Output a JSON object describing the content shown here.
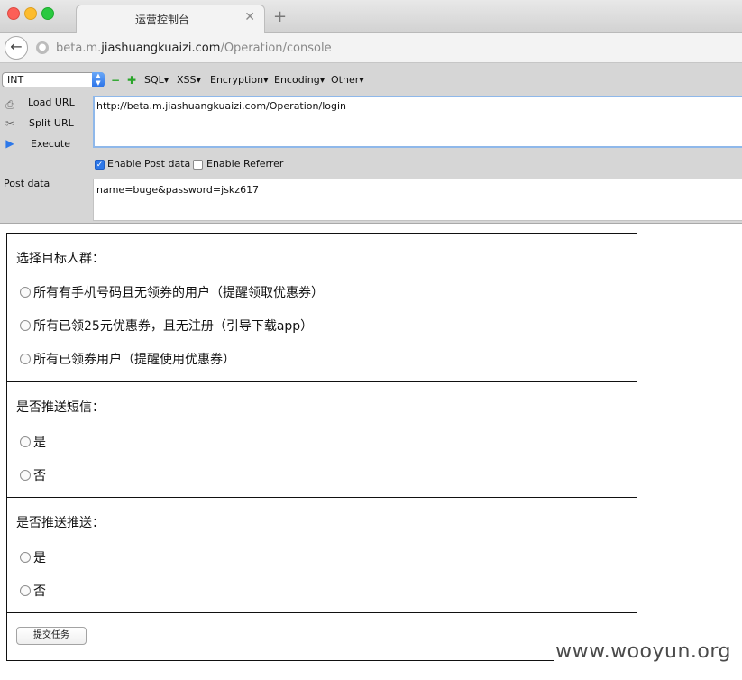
{
  "browser": {
    "tab_title": "运营控制台",
    "tab_close": "✕",
    "new_tab": "+",
    "url_prefix": "beta.m.",
    "url_domain": "jiashuangkuaizi.com",
    "url_path": "/Operation/console"
  },
  "hackbar": {
    "select_value": "INT",
    "menus": [
      "SQL",
      "XSS",
      "Encryption",
      "Encoding",
      "Other"
    ],
    "load_url_label": "Load URL",
    "split_url_label": "Split URL",
    "execute_label": "Execute",
    "url_value": "http://beta.m.jiashuangkuaizi.com/Operation/login",
    "enable_post_label": "Enable Post data",
    "enable_post_checked": true,
    "enable_referrer_label": "Enable Referrer",
    "enable_referrer_checked": false,
    "post_data_label": "Post data",
    "post_data_value": "name=buge&password=jskz617"
  },
  "form": {
    "target_question": "选择目标人群：",
    "target_options": [
      "所有有手机号码且无领券的用户（提醒领取优惠券）",
      "所有已领25元优惠券，且无注册（引导下载app）",
      "所有已领券用户（提醒使用优惠券）"
    ],
    "sms_question": "是否推送短信：",
    "sms_options": [
      "是",
      "否"
    ],
    "push_question": "是否推送推送：",
    "push_options": [
      "是",
      "否"
    ],
    "submit_label": "提交任务"
  },
  "watermark": "www.wooyun.org",
  "colors": {
    "accent": "#2d78e9",
    "toolbar_bg": "#d6d6d6",
    "url_focus_border": "#8fb8ea"
  }
}
